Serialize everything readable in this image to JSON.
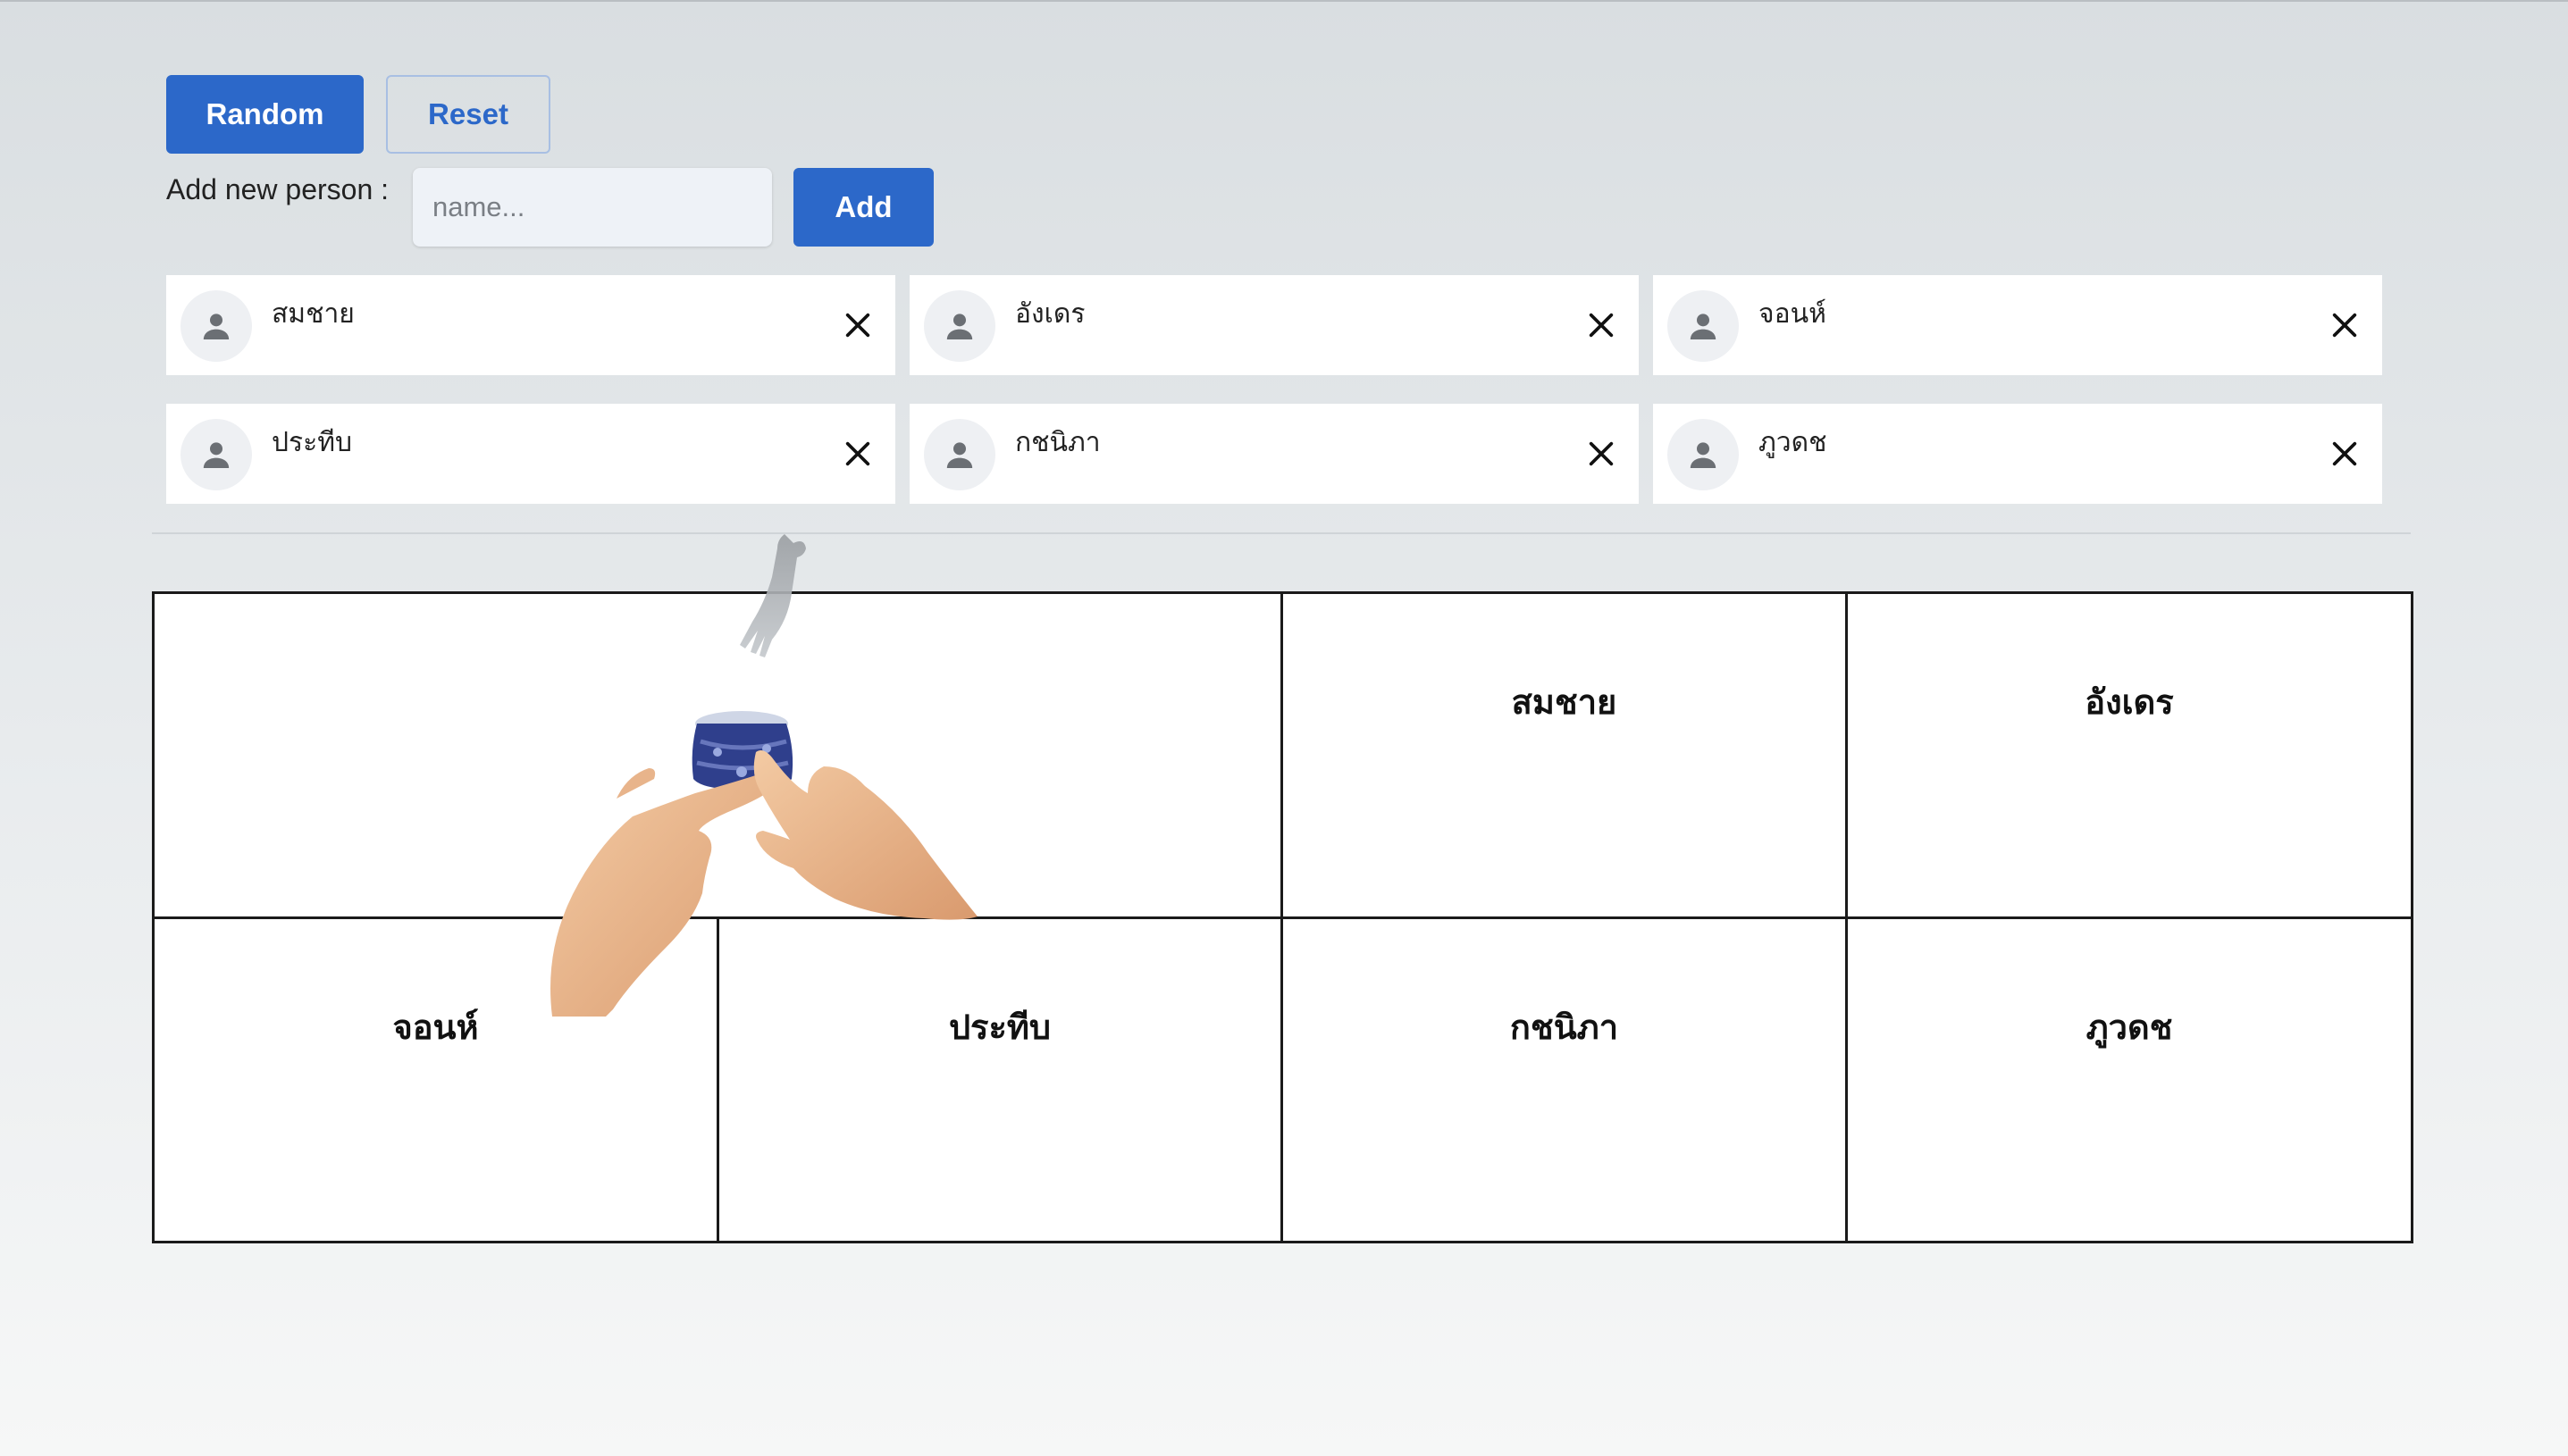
{
  "controls": {
    "random_label": "Random",
    "reset_label": "Reset",
    "add_label": "Add new person :",
    "name_placeholder": "name...",
    "add_button_label": "Add"
  },
  "people": [
    {
      "name": "สมชาย"
    },
    {
      "name": "อังเดร"
    },
    {
      "name": "จอนห์"
    },
    {
      "name": "ประทีบ"
    },
    {
      "name": "กชนิภา"
    },
    {
      "name": "ภูวดช"
    }
  ],
  "seats": [
    {
      "label": ""
    },
    {
      "label": "สมชาย"
    },
    {
      "label": "อังเดร"
    },
    {
      "label": "จอนห์"
    },
    {
      "label": "ประทีบ"
    },
    {
      "label": "กชนิภา"
    },
    {
      "label": "ภูวดช"
    }
  ],
  "colors": {
    "primary": "#2c68c9",
    "card_background": "#ffffff",
    "page_background": "#d9dee1"
  },
  "icons": {
    "avatar": "person-icon",
    "remove": "close-icon"
  }
}
